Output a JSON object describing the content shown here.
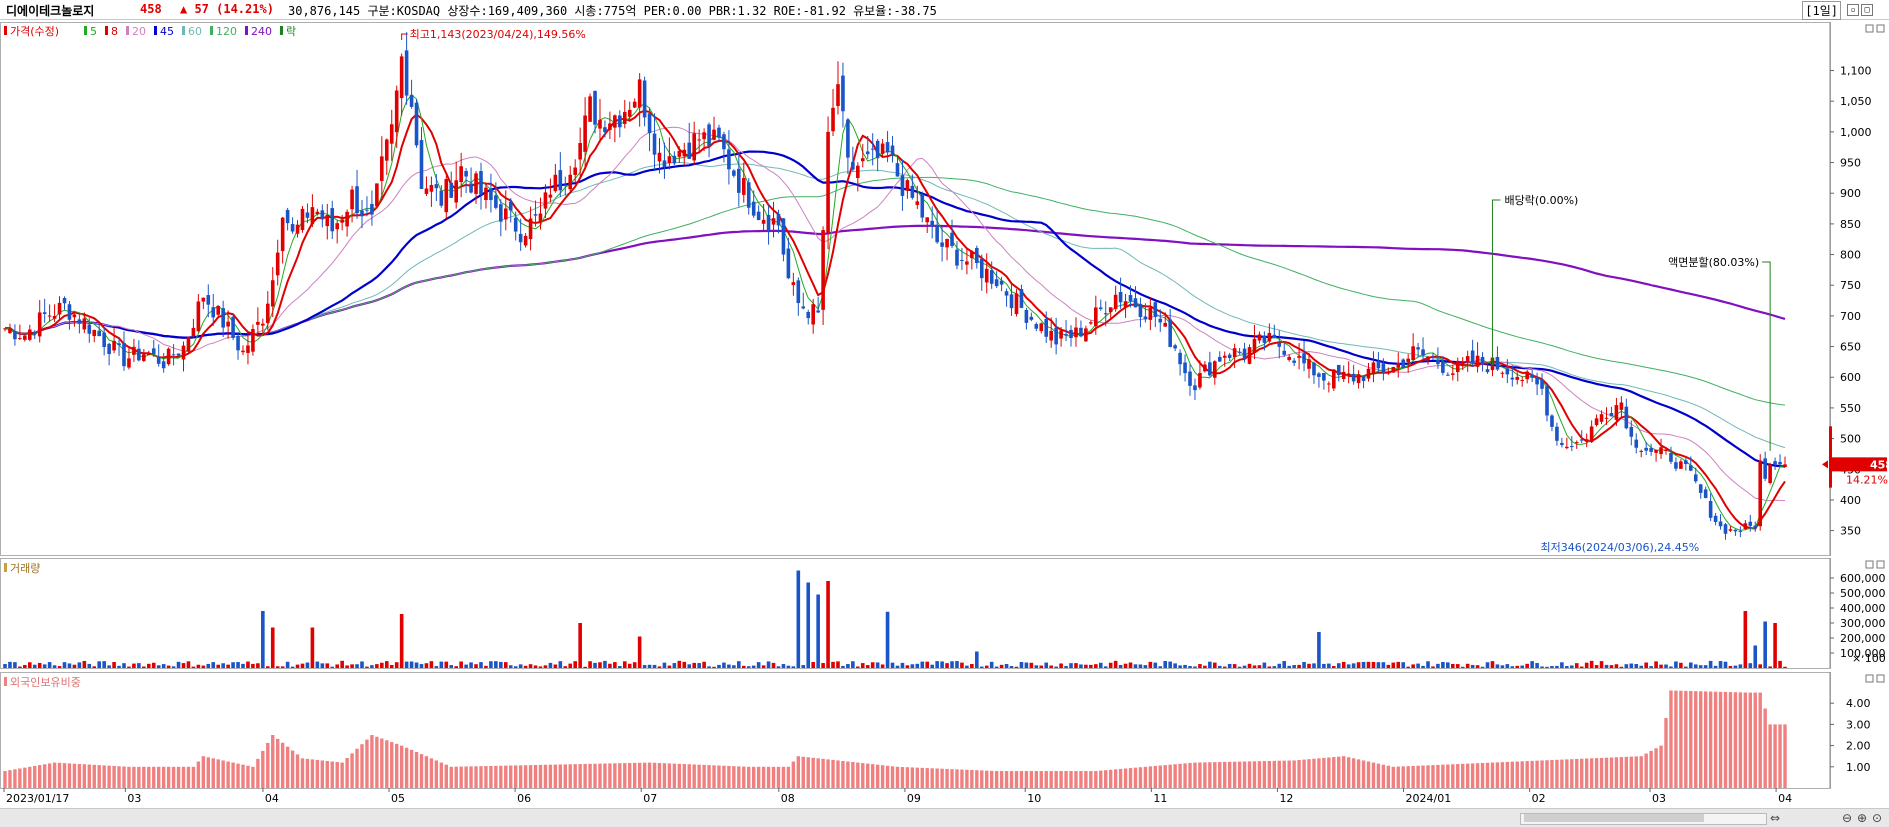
{
  "header": {
    "stock_name": "디에이테크놀로지",
    "price": "458",
    "change": "▲ 57 (14.21%)",
    "info": "30,876,145  구분:KOSDAQ 상장수:169,409,360 시총:775억 PER:0.00 PBR:1.32 ROE:-81.92 유보율:-38.75",
    "period": "[1일]"
  },
  "legend": {
    "price_label": "가격(수정)",
    "ma": [
      {
        "label": "5",
        "color": "#22aa22"
      },
      {
        "label": "8",
        "color": "#e00000"
      },
      {
        "label": "20",
        "color": "#d080c0"
      },
      {
        "label": "45",
        "color": "#0000cc"
      },
      {
        "label": "60",
        "color": "#70b8b8"
      },
      {
        "label": "120",
        "color": "#40b060"
      },
      {
        "label": "240",
        "color": "#8010c0"
      }
    ],
    "ex_label": "락",
    "volume_label": "거래량",
    "foreign_label": "외국인보유비중"
  },
  "annotations": {
    "high": "최고1,143(2023/04/24),149.56%",
    "low": "최저346(2024/03/06),24.45%",
    "dividend": "배당락(0.00%)",
    "split": "액면분할(80.03%)",
    "current_price": "458",
    "current_pct": "14.21%"
  },
  "colors": {
    "up": "#e00000",
    "down": "#1a55c8",
    "foreign_bar": "#f08080",
    "grid": "#dddddd"
  },
  "chart_data": {
    "type": "candlestick",
    "x_ticks": [
      "2023/01/17",
      "03",
      "04",
      "05",
      "06",
      "07",
      "08",
      "09",
      "10",
      "11",
      "12",
      "2024/01",
      "02",
      "03",
      "04"
    ],
    "price_axis": {
      "ticks": [
        350,
        400,
        450,
        500,
        550,
        600,
        650,
        700,
        750,
        800,
        850,
        900,
        950,
        1000,
        1050,
        1100
      ],
      "labels": [
        "350",
        "400",
        "450",
        "500",
        "550",
        "600",
        "650",
        "700",
        "750",
        "800",
        "850",
        "900",
        "950",
        "1,000",
        "1,050",
        "1,100"
      ],
      "range": [
        320,
        1140
      ]
    },
    "volume_axis": {
      "ticks": [
        100000,
        200000,
        300000,
        400000,
        500000,
        600000
      ],
      "labels": [
        "100,000",
        "200,000",
        "300,000",
        "400,000",
        "500,000",
        "600,000"
      ],
      "unit_label": "× 100",
      "range": [
        0,
        680000
      ]
    },
    "foreign_axis": {
      "ticks": [
        1,
        2,
        3,
        4
      ],
      "labels": [
        "1.00",
        "2.00",
        "3.00",
        "4.00"
      ],
      "range": [
        0,
        5
      ]
    },
    "price_keypoints": [
      [
        0,
        680
      ],
      [
        4,
        670
      ],
      [
        8,
        700
      ],
      [
        12,
        715
      ],
      [
        16,
        690
      ],
      [
        20,
        660
      ],
      [
        24,
        630
      ],
      [
        28,
        640
      ],
      [
        32,
        625
      ],
      [
        36,
        650
      ],
      [
        40,
        735
      ],
      [
        44,
        690
      ],
      [
        48,
        640
      ],
      [
        52,
        700
      ],
      [
        54,
        760
      ],
      [
        56,
        880
      ],
      [
        58,
        830
      ],
      [
        62,
        880
      ],
      [
        66,
        840
      ],
      [
        70,
        895
      ],
      [
        74,
        850
      ],
      [
        76,
        940
      ],
      [
        78,
        1000
      ],
      [
        80,
        1120
      ],
      [
        82,
        1050
      ],
      [
        84,
        920
      ],
      [
        88,
        890
      ],
      [
        92,
        940
      ],
      [
        96,
        900
      ],
      [
        100,
        870
      ],
      [
        104,
        840
      ],
      [
        108,
        860
      ],
      [
        110,
        910
      ],
      [
        112,
        920
      ],
      [
        116,
        980
      ],
      [
        118,
        1040
      ],
      [
        120,
        1020
      ],
      [
        124,
        1030
      ],
      [
        128,
        1070
      ],
      [
        132,
        960
      ],
      [
        136,
        970
      ],
      [
        140,
        990
      ],
      [
        144,
        980
      ],
      [
        148,
        920
      ],
      [
        152,
        870
      ],
      [
        156,
        850
      ],
      [
        158,
        760
      ],
      [
        160,
        720
      ],
      [
        164,
        700
      ],
      [
        166,
        980
      ],
      [
        168,
        1080
      ],
      [
        170,
        940
      ],
      [
        174,
        950
      ],
      [
        178,
        960
      ],
      [
        182,
        900
      ],
      [
        184,
        880
      ],
      [
        188,
        820
      ],
      [
        192,
        800
      ],
      [
        196,
        780
      ],
      [
        200,
        760
      ],
      [
        204,
        720
      ],
      [
        208,
        690
      ],
      [
        212,
        660
      ],
      [
        216,
        670
      ],
      [
        220,
        700
      ],
      [
        224,
        735
      ],
      [
        228,
        720
      ],
      [
        232,
        700
      ],
      [
        236,
        650
      ],
      [
        238,
        610
      ],
      [
        240,
        590
      ],
      [
        242,
        610
      ],
      [
        246,
        640
      ],
      [
        250,
        640
      ],
      [
        254,
        660
      ],
      [
        258,
        650
      ],
      [
        262,
        620
      ],
      [
        266,
        600
      ],
      [
        272,
        600
      ],
      [
        276,
        610
      ],
      [
        280,
        615
      ],
      [
        284,
        640
      ],
      [
        288,
        630
      ],
      [
        292,
        610
      ],
      [
        296,
        625
      ],
      [
        300,
        620
      ],
      [
        304,
        610
      ],
      [
        308,
        590
      ],
      [
        310,
        580
      ],
      [
        312,
        520
      ],
      [
        314,
        490
      ],
      [
        318,
        495
      ],
      [
        322,
        540
      ],
      [
        326,
        560
      ],
      [
        328,
        500
      ],
      [
        332,
        480
      ],
      [
        336,
        470
      ],
      [
        340,
        440
      ],
      [
        344,
        380
      ],
      [
        346,
        355
      ],
      [
        348,
        350
      ],
      [
        350,
        352
      ],
      [
        352,
        356
      ],
      [
        353,
        360
      ],
      [
        354,
        460
      ],
      [
        355,
        430
      ],
      [
        356,
        458
      ]
    ],
    "volume_spikes": [
      [
        52,
        380000
      ],
      [
        54,
        270000
      ],
      [
        62,
        270000
      ],
      [
        80,
        360000
      ],
      [
        116,
        300000
      ],
      [
        128,
        210000
      ],
      [
        160,
        650000
      ],
      [
        162,
        570000
      ],
      [
        164,
        490000
      ],
      [
        166,
        580000
      ],
      [
        178,
        375000
      ],
      [
        196,
        110000
      ],
      [
        265,
        240000
      ],
      [
        351,
        380000
      ],
      [
        353,
        150000
      ],
      [
        355,
        310000
      ],
      [
        357,
        300000
      ]
    ],
    "foreign_ratio_keypoints": [
      [
        0,
        0.8
      ],
      [
        10,
        1.2
      ],
      [
        25,
        1.0
      ],
      [
        38,
        1.0
      ],
      [
        40,
        1.5
      ],
      [
        50,
        1.0
      ],
      [
        54,
        2.5
      ],
      [
        60,
        1.4
      ],
      [
        68,
        1.2
      ],
      [
        74,
        2.5
      ],
      [
        80,
        2.0
      ],
      [
        90,
        1.0
      ],
      [
        110,
        1.1
      ],
      [
        130,
        1.2
      ],
      [
        150,
        1.0
      ],
      [
        158,
        1.0
      ],
      [
        160,
        1.5
      ],
      [
        180,
        1.0
      ],
      [
        200,
        0.8
      ],
      [
        220,
        0.8
      ],
      [
        240,
        1.2
      ],
      [
        260,
        1.3
      ],
      [
        270,
        1.5
      ],
      [
        280,
        1.0
      ],
      [
        300,
        1.2
      ],
      [
        320,
        1.4
      ],
      [
        330,
        1.5
      ],
      [
        334,
        2.0
      ],
      [
        336,
        4.6
      ],
      [
        352,
        4.5
      ],
      [
        354,
        4.5
      ],
      [
        356,
        3.0
      ],
      [
        358,
        3.0
      ]
    ]
  }
}
